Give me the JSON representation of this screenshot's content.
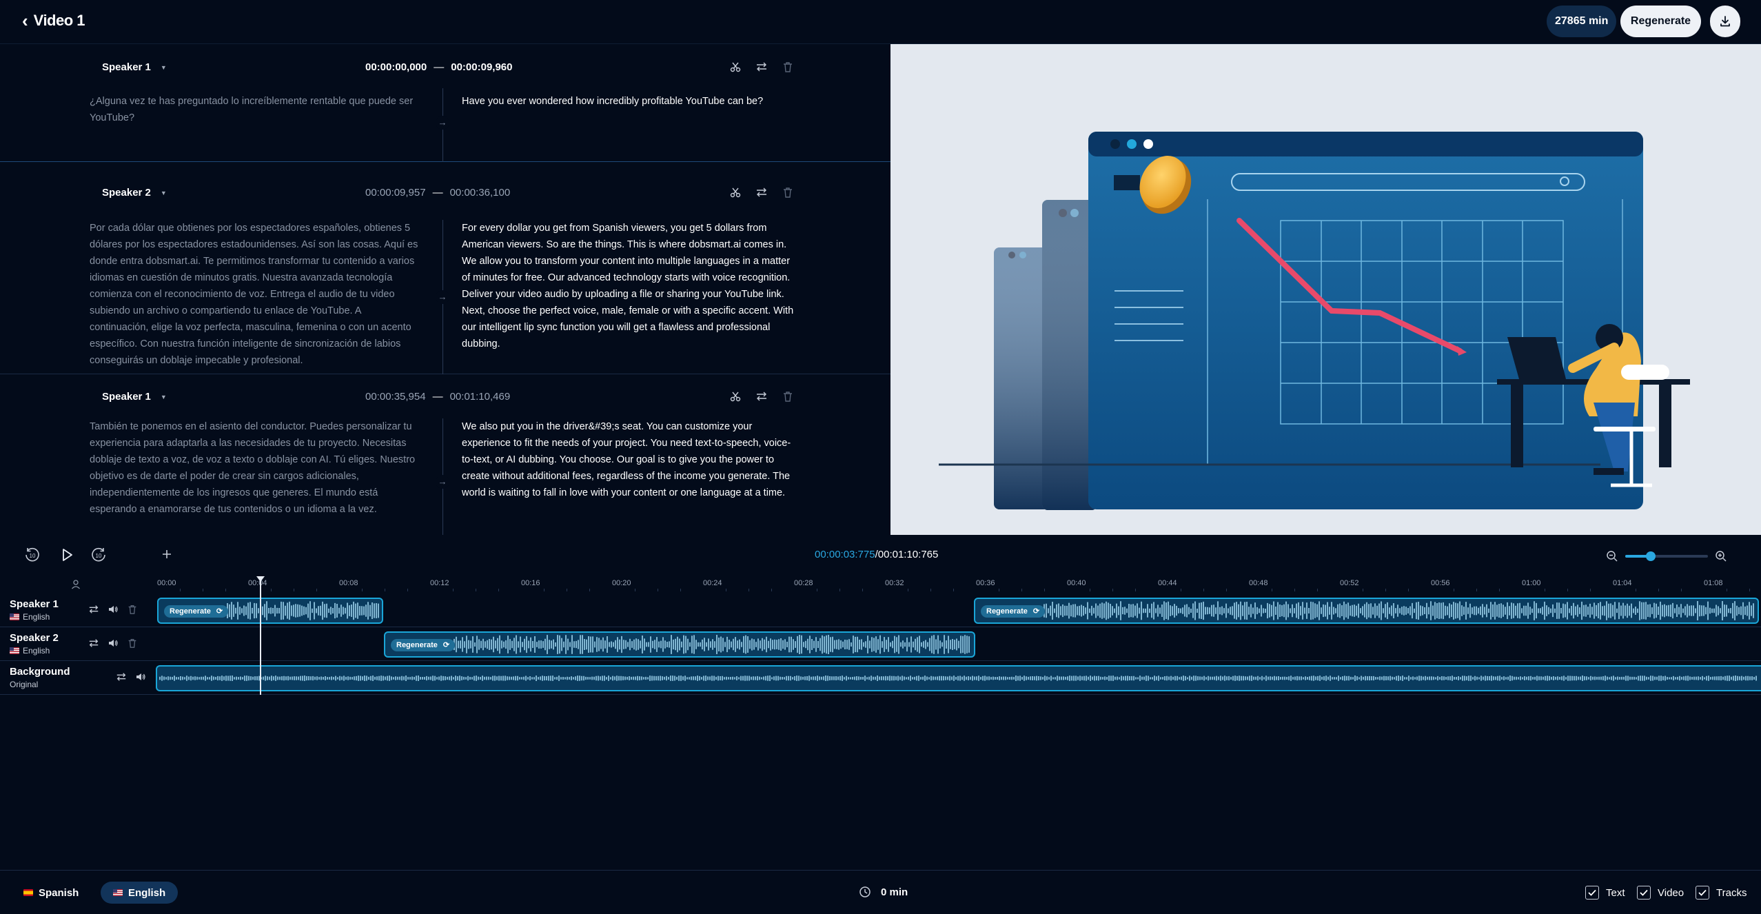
{
  "header": {
    "back_label": "Video 1",
    "minutes_balance": "27865 min",
    "regenerate_label": "Regenerate"
  },
  "segments": [
    {
      "speaker": "Speaker 1",
      "start": "00:00:00,000",
      "end": "00:00:09,960",
      "original": "¿Alguna vez te has preguntado lo increíblemente rentable que puede ser YouTube?",
      "translation": "Have you ever wondered how incredibly profitable YouTube can be?"
    },
    {
      "speaker": "Speaker 2",
      "start": "00:00:09,957",
      "end": "00:00:36,100",
      "original": "Por cada dólar que obtienes por los espectadores españoles, obtienes 5 dólares por los espectadores estadounidenses. Así son las cosas. Aquí es donde entra dobsmart.ai. Te permitimos transformar tu contenido a varios idiomas en cuestión de minutos gratis. Nuestra avanzada tecnología comienza con el reconocimiento de voz. Entrega el audio de tu video subiendo un archivo o compartiendo tu enlace de YouTube. A continuación, elige la voz perfecta, masculina, femenina o con un acento específico. Con nuestra función inteligente de sincronización de labios conseguirás un doblaje impecable y profesional.",
      "translation": "For every dollar you get from Spanish viewers, you get 5 dollars from American viewers. So are the things. This is where dobsmart.ai comes in. We allow you to transform your content into multiple languages in a matter of minutes for free. Our advanced technology starts with voice recognition. Deliver your video audio by uploading a file or sharing your YouTube link. Next, choose the perfect voice, male, female or with a specific accent. With our intelligent lip sync function you will get a flawless and professional dubbing."
    },
    {
      "speaker": "Speaker 1",
      "start": "00:00:35,954",
      "end": "00:01:10,469",
      "original": "También te ponemos en el asiento del conductor. Puedes personalizar tu experiencia para adaptarla a las necesidades de tu proyecto. Necesitas doblaje de texto a voz, de voz a texto o doblaje con AI. Tú eliges. Nuestro objetivo es de darte el poder de crear sin cargos adicionales, independientemente de los ingresos que generes. El mundo está esperando a enamorarse de tus contenidos o un idioma a la vez.",
      "translation": "We also put you in the driver&#39;s seat. You can customize your experience to fit the needs of your project. You need text-to-speech, voice-to-text, or AI dubbing. You choose. Our goal is to give you the power to create without additional fees, regardless of the income you generate. The world is waiting to fall in love with your content or one language at a time."
    }
  ],
  "player": {
    "current_time": "00:00:03:775",
    "total_time": "/00:01:10:765",
    "progress_fraction": 0.053
  },
  "timeline": {
    "ticks": [
      "00:00",
      "00:04",
      "00:08",
      "00:12",
      "00:16",
      "00:20",
      "00:24",
      "00:28",
      "00:32",
      "00:36",
      "00:40",
      "00:44",
      "00:48",
      "00:52",
      "00:56",
      "01:00",
      "01:04",
      "01:08"
    ],
    "tracks": [
      {
        "name": "Speaker 1",
        "lang": "English"
      },
      {
        "name": "Speaker 2",
        "lang": "English"
      },
      {
        "name": "Background",
        "lang": "Original"
      }
    ],
    "clip_label": "Regenerate"
  },
  "bottom": {
    "lang_source": "Spanish",
    "lang_target": "English",
    "minutes_used": "0 min",
    "check_text": "Text",
    "check_video": "Video",
    "check_tracks": "Tracks"
  },
  "colors": {
    "background": "#030b1a",
    "accent": "#2aa7e0",
    "clip_border": "#1aa6d8",
    "chart_line": "#e84a6a"
  },
  "icons": {
    "back": "chevron-left-icon",
    "download": "download-icon",
    "split": "scissors-icon",
    "swap": "swap-icon",
    "delete": "trash-icon",
    "rewind": "rewind-10-icon",
    "play": "play-icon",
    "forward": "forward-10-icon",
    "add": "plus-icon",
    "zoom_out": "zoom-out-icon",
    "zoom_in": "zoom-in-icon",
    "volume": "volume-icon",
    "user": "user-icon",
    "clock": "clock-icon"
  }
}
